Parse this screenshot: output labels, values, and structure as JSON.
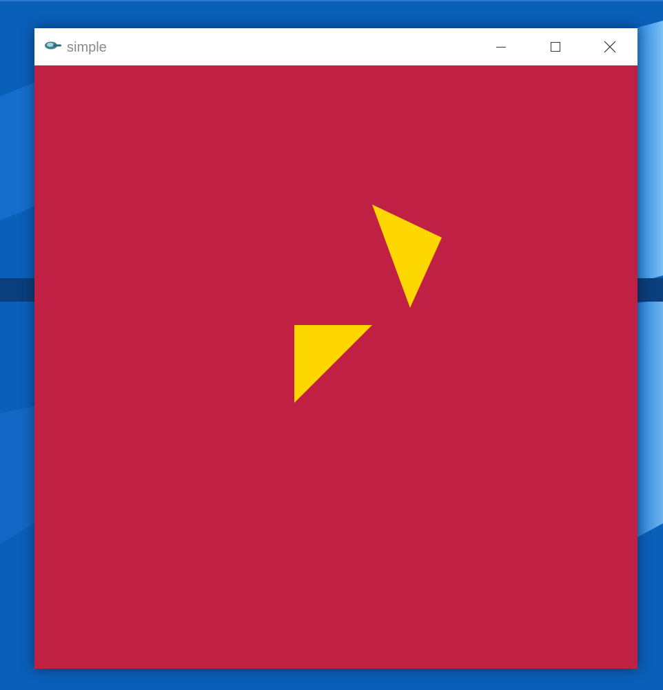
{
  "window": {
    "title": "simple",
    "app_icon": "app-logo-icon",
    "controls": {
      "minimize_icon": "minimize-icon",
      "maximize_icon": "maximize-icon",
      "close_icon": "close-icon"
    }
  },
  "canvas": {
    "background_color": "#c02044",
    "shape_color": "#ffd700",
    "shapes": [
      "triangle",
      "triangle"
    ]
  },
  "desktop": {
    "wallpaper_color": "#0a61bd"
  }
}
